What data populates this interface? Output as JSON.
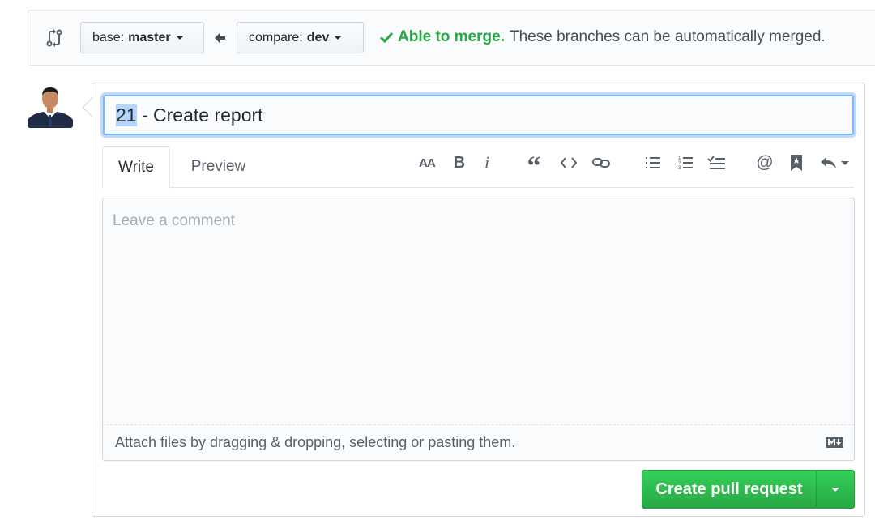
{
  "compare": {
    "base_prefix": "base:",
    "base_branch": "master",
    "compare_prefix": "compare:",
    "compare_branch": "dev",
    "status_ok": "Able to merge.",
    "status_desc": "These branches can be automatically merged."
  },
  "form": {
    "title_selected": "21",
    "title_rest": " - Create report",
    "tabs": [
      {
        "label": "Write"
      },
      {
        "label": "Preview"
      }
    ],
    "comment_placeholder": "Leave a comment",
    "attach_text": "Attach files by dragging & dropping, selecting or pasting them.",
    "submit_label": "Create pull request"
  },
  "toolbar": {
    "heading": "AA",
    "bold": "B",
    "italic": "i",
    "quote": "“",
    "mention": "@"
  },
  "colors": {
    "success": "#28a745",
    "focus": "#79b8ff",
    "accent_button": "#2cbe4e"
  },
  "icons": [
    "git-compare-icon",
    "caret-down-icon",
    "arrow-left-icon",
    "check-icon",
    "heading-icon",
    "bold-icon",
    "italic-icon",
    "quote-icon",
    "code-icon",
    "link-icon",
    "unordered-list-icon",
    "ordered-list-icon",
    "task-list-icon",
    "mention-icon",
    "saved-reply-icon",
    "reply-icon",
    "markdown-icon"
  ]
}
